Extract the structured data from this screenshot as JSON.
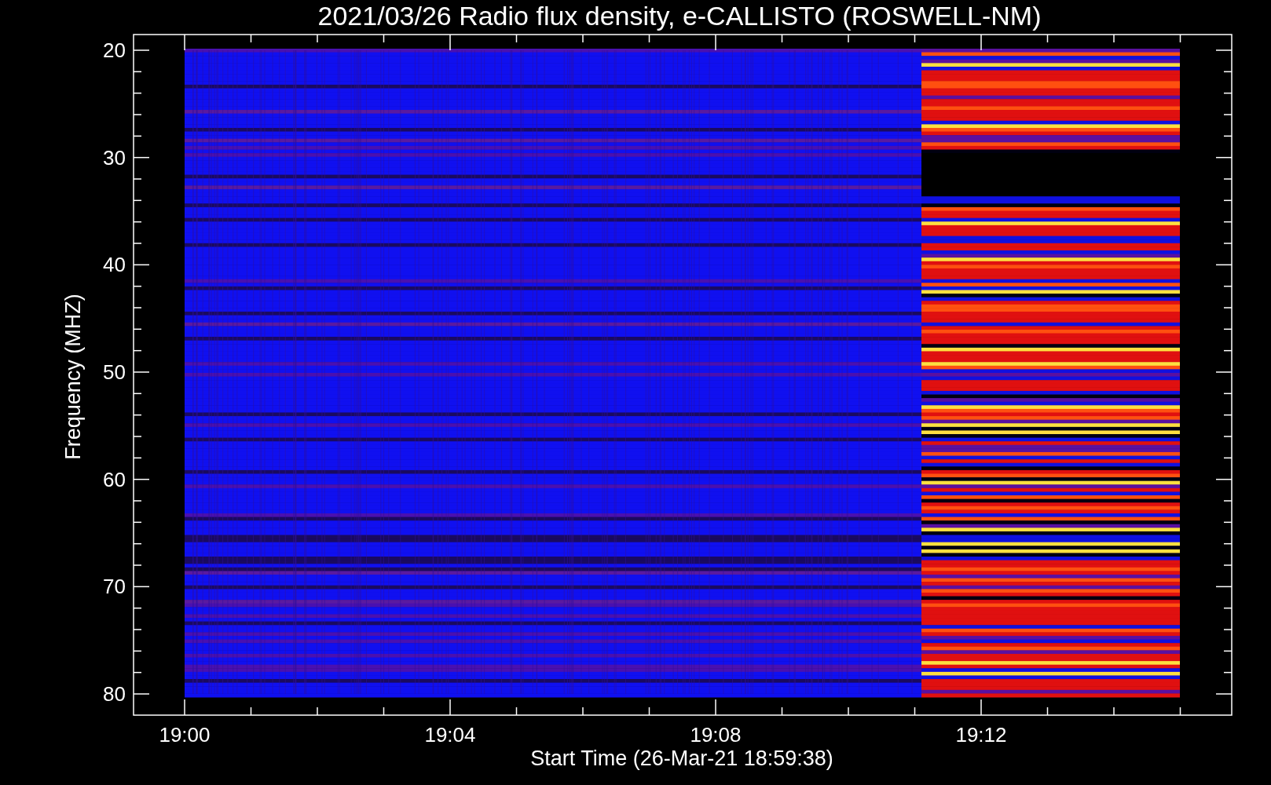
{
  "title": "2021/03/26  Radio flux density, e-CALLISTO (ROSWELL-NM)",
  "y_axis": {
    "label": "Frequency (MHZ)",
    "ticks": [
      "20",
      "30",
      "40",
      "50",
      "60",
      "70",
      "80"
    ]
  },
  "x_axis": {
    "label": "Start Time (26-Mar-21 18:59:38)",
    "ticks": [
      "19:00",
      "19:04",
      "19:08",
      "19:12"
    ]
  }
}
